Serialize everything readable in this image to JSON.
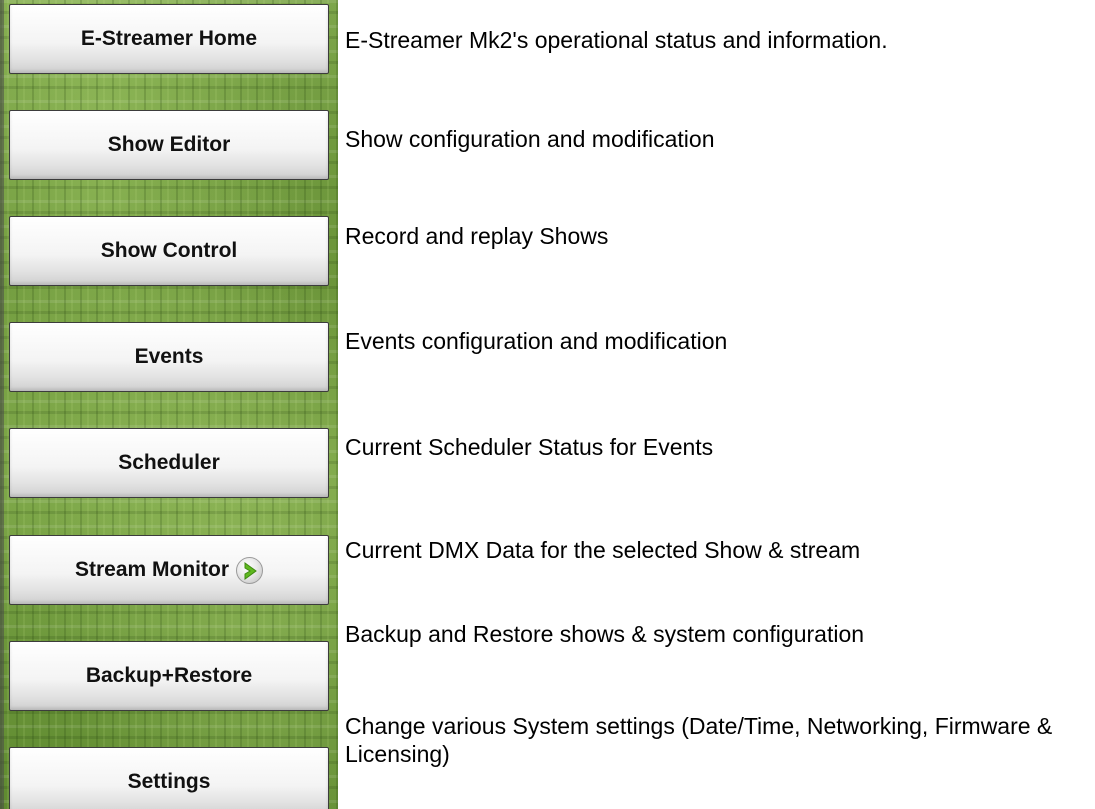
{
  "nav": [
    {
      "label": "E-Streamer Home",
      "description": "E-Streamer Mk2's operational status and information."
    },
    {
      "label": "Show Editor",
      "description": "Show configuration and modification"
    },
    {
      "label": "Show Control",
      "description": "Record and replay Shows"
    },
    {
      "label": "Events",
      "description": "Events configuration and modification"
    },
    {
      "label": "Scheduler",
      "description": "Current Scheduler Status for Events"
    },
    {
      "label": "Stream Monitor",
      "description": "Current DMX Data for the selected Show & stream",
      "icon": "arrow-right-icon"
    },
    {
      "label": "Backup+Restore",
      "description": "Backup and Restore shows & system configuration"
    },
    {
      "label": "Settings",
      "description": "Change various System settings (Date/Time, Networking, Firmware & Licensing)"
    }
  ],
  "colors": {
    "sidebar_green": "#6f9a3c",
    "icon_arrow_green": "#5fb81f"
  }
}
